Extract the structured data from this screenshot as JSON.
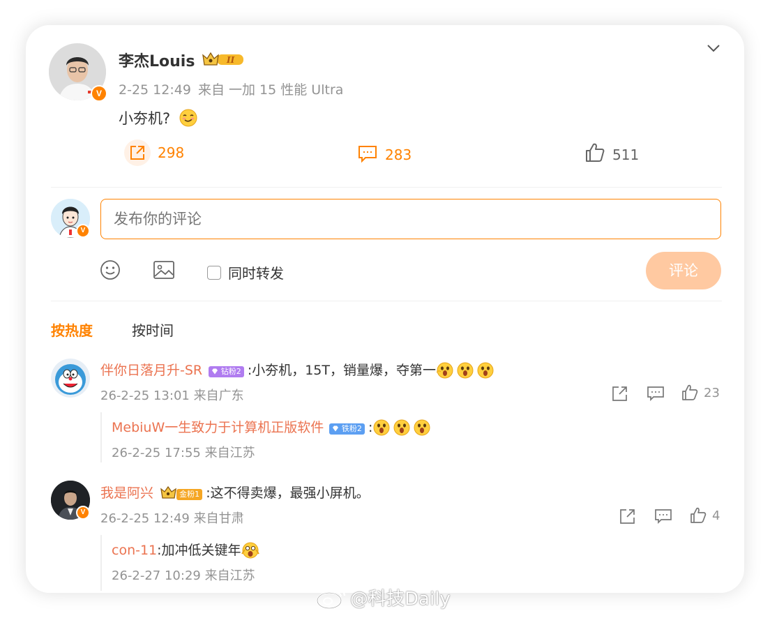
{
  "post": {
    "author": "李杰Louis",
    "time": "2-25 12:49",
    "source": "来自 一加 15 性能 Ultra",
    "text": "小夯机?",
    "repost_count": "298",
    "comment_count": "283",
    "like_count": "511"
  },
  "composer": {
    "placeholder": "发布你的评论",
    "also_repost": "同时转发",
    "submit": "评论"
  },
  "tabs": {
    "hot": "按热度",
    "time": "按时间"
  },
  "comments": [
    {
      "user": "伴你日落月升-SR",
      "badge": "钻粉2",
      "text": ":小夯机，15T，销量爆，夺第一",
      "meta": "26-2-25 13:01 来自广东",
      "likes": "23",
      "reply": {
        "user": "MebiuW一生致力于计算机正版软件",
        "badge": "铁粉2",
        "text": ":",
        "meta": "26-2-25 17:55 来自江苏"
      }
    },
    {
      "user": "我是阿兴",
      "badge": "金粉1",
      "text": ":这不得卖爆，最强小屏机。",
      "meta": "26-2-25 12:49 来自甘肃",
      "likes": "4",
      "reply": {
        "user": "con-11",
        "text": ":加冲低关键年",
        "meta": "26-2-27 10:29 来自江苏"
      }
    }
  ],
  "watermark": "@科技Daily",
  "colors": {
    "accent": "#ff8200",
    "username": "#eb7350",
    "meta": "#939393"
  }
}
